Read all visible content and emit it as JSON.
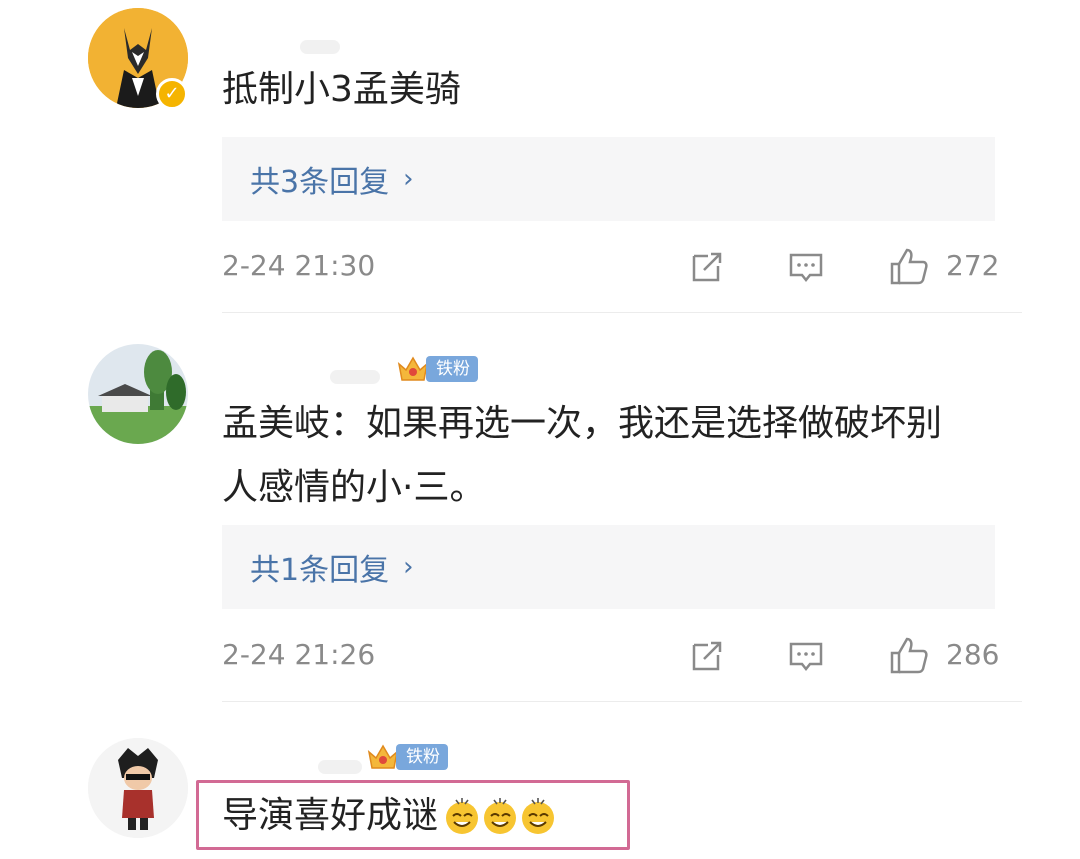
{
  "comments": [
    {
      "text": "抵制小3孟美骑",
      "reply_label": "共3条回复",
      "time": "2-24 21:30",
      "likes": "272",
      "avatar_icon": "verified-fox-avatar"
    },
    {
      "badge": "铁粉",
      "text_line1": "孟美岐：如果再选一次，我还是选择做破坏别",
      "text_line2": "人感情的小·三。",
      "reply_label": "共1条回复",
      "time": "2-24 21:26",
      "likes": "286",
      "avatar_icon": "landscape-avatar"
    },
    {
      "badge": "铁粉",
      "text": "导演喜好成谜",
      "emoji_icon": "sweat-smile-emoji",
      "avatar_icon": "cartoon-character-avatar"
    }
  ],
  "colors": {
    "link_blue": "#4a74a8",
    "badge_blue": "#79a7dc",
    "highlight_pink": "#d26a94",
    "meta_gray": "#8a8a8a"
  }
}
